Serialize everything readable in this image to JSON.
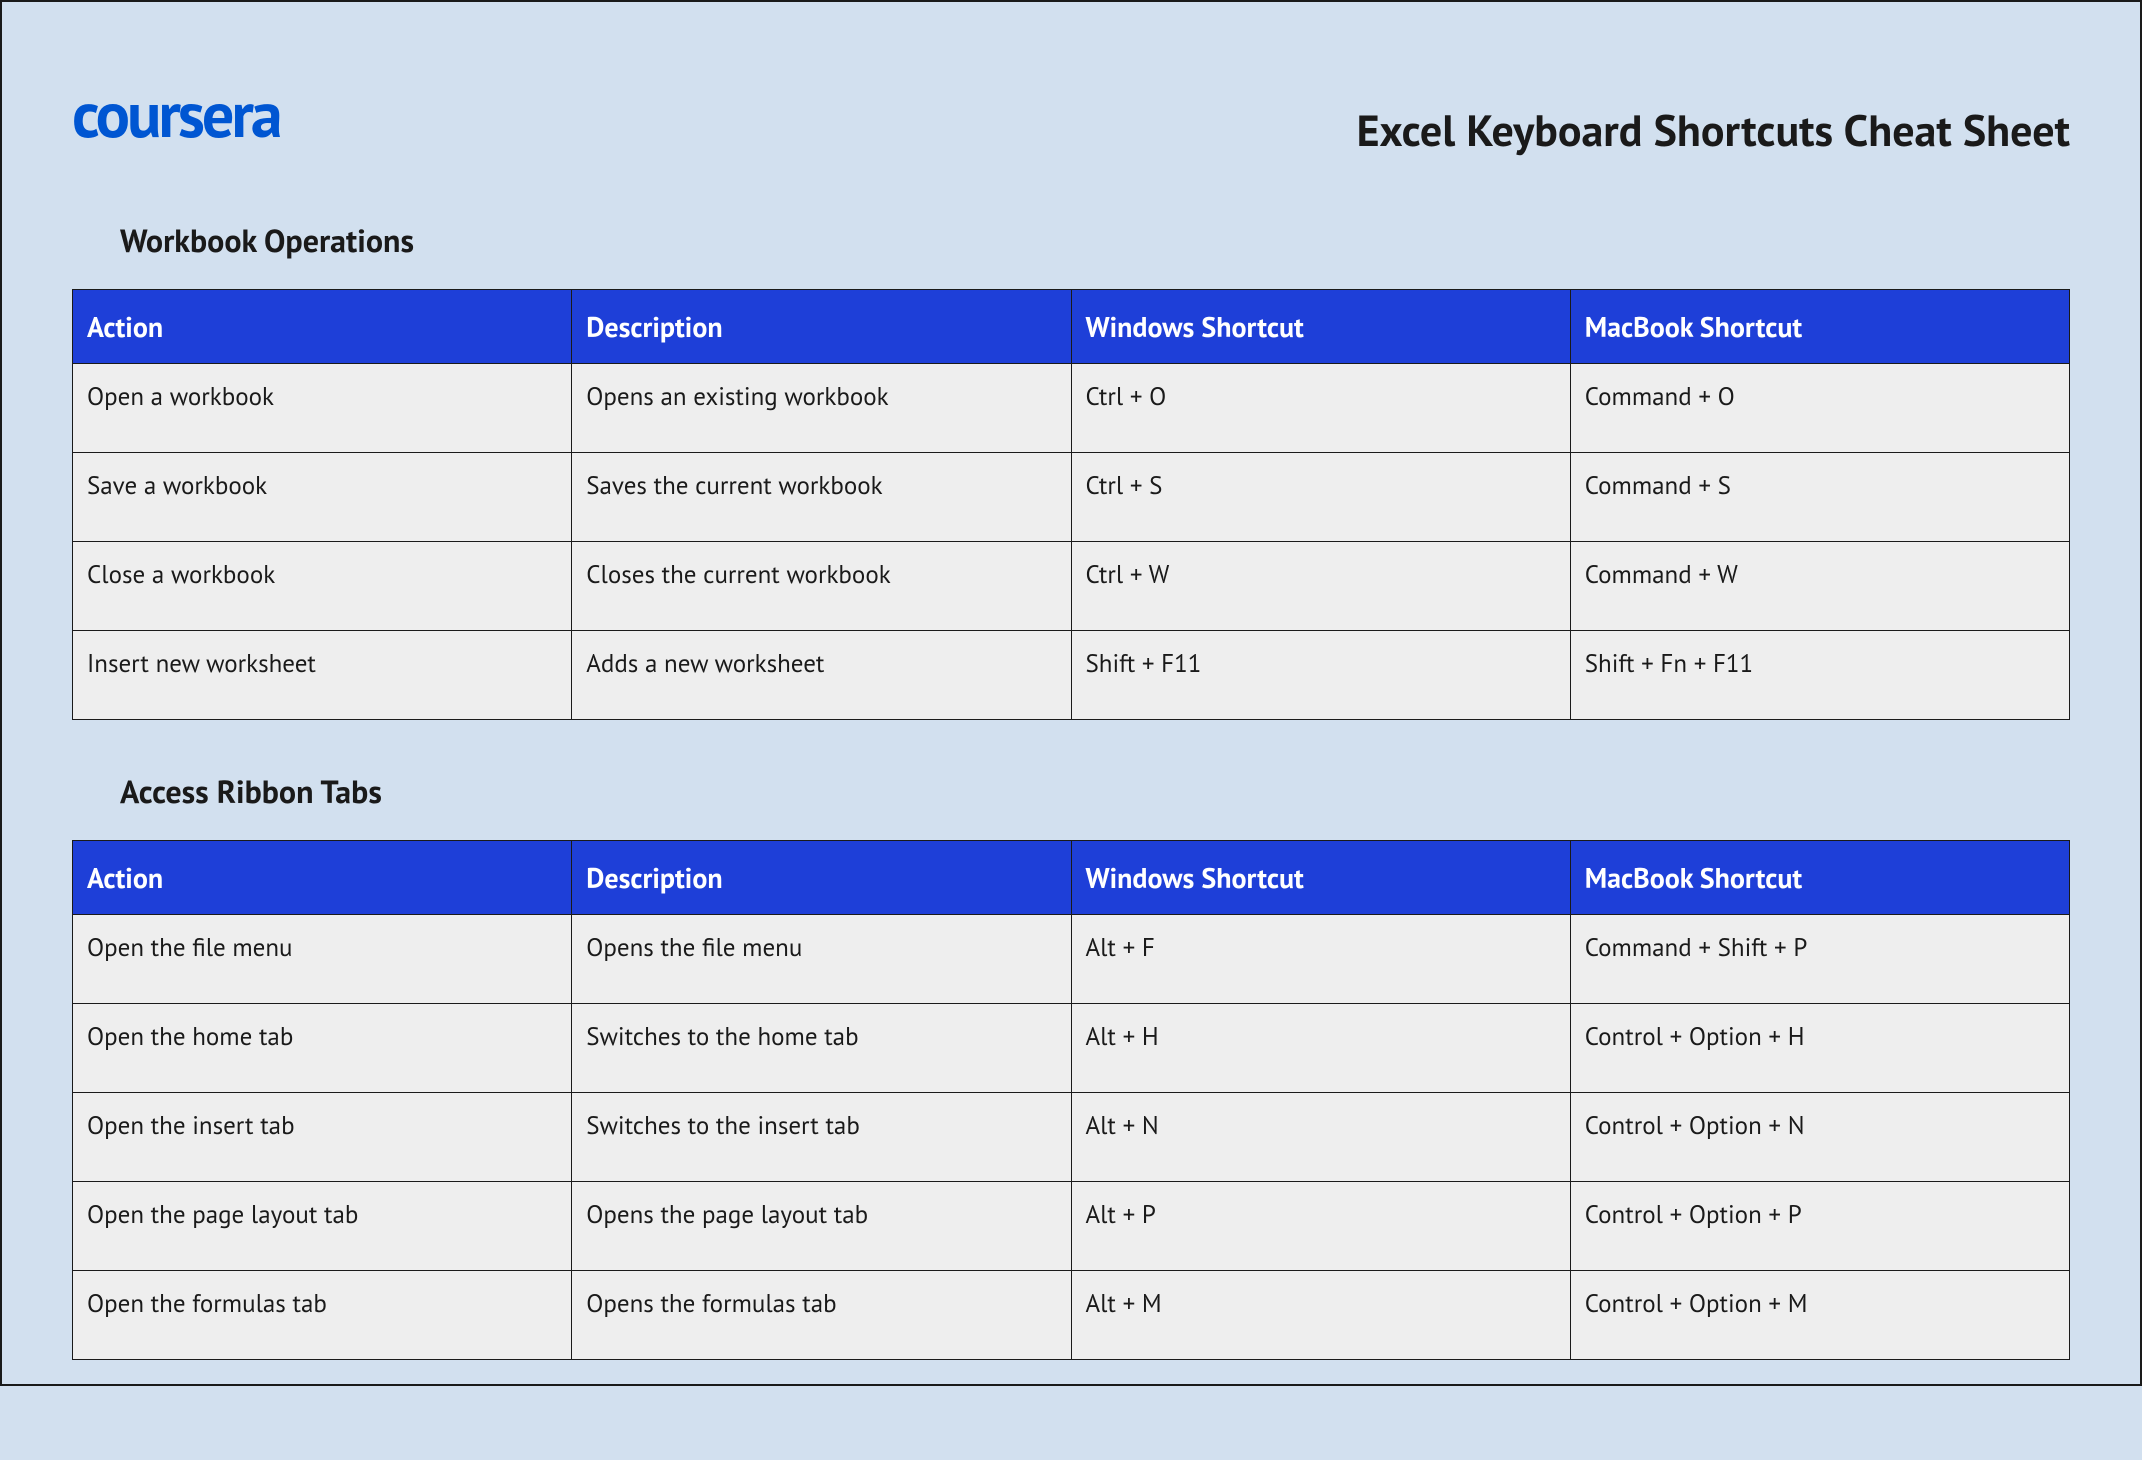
{
  "logo_text": "coursera",
  "page_title": "Excel Keyboard Shortcuts Cheat Sheet",
  "columns": {
    "action": "Action",
    "description": "Description",
    "windows": "Windows Shortcut",
    "mac": "MacBook Shortcut"
  },
  "sections": [
    {
      "title": "Workbook Operations",
      "rows": [
        {
          "action": "Open a workbook",
          "description": "Opens an existing workbook",
          "windows": "Ctrl + O",
          "mac": "Command + O"
        },
        {
          "action": "Save a workbook",
          "description": "Saves the current workbook",
          "windows": "Ctrl + S",
          "mac": "Command + S"
        },
        {
          "action": "Close a workbook",
          "description": "Closes the current workbook",
          "windows": "Ctrl + W",
          "mac": "Command + W"
        },
        {
          "action": "Insert new worksheet",
          "description": "Adds a new worksheet",
          "windows": "Shift + F11",
          "mac": "Shift + Fn + F11"
        }
      ]
    },
    {
      "title": "Access Ribbon Tabs",
      "rows": [
        {
          "action": "Open the file menu",
          "description": "Opens the file menu",
          "windows": "Alt + F",
          "mac": "Command + Shift + P"
        },
        {
          "action": "Open the home tab",
          "description": "Switches to the home tab",
          "windows": "Alt + H",
          "mac": "Control + Option + H"
        },
        {
          "action": "Open the insert tab",
          "description": "Switches to the insert tab",
          "windows": "Alt + N",
          "mac": "Control + Option + N"
        },
        {
          "action": "Open the page layout tab",
          "description": "Opens the page layout tab",
          "windows": "Alt + P",
          "mac": "Control + Option + P"
        },
        {
          "action": "Open the formulas tab",
          "description": "Opens the formulas tab",
          "windows": "Alt + M",
          "mac": "Control + Option + M"
        }
      ]
    }
  ]
}
